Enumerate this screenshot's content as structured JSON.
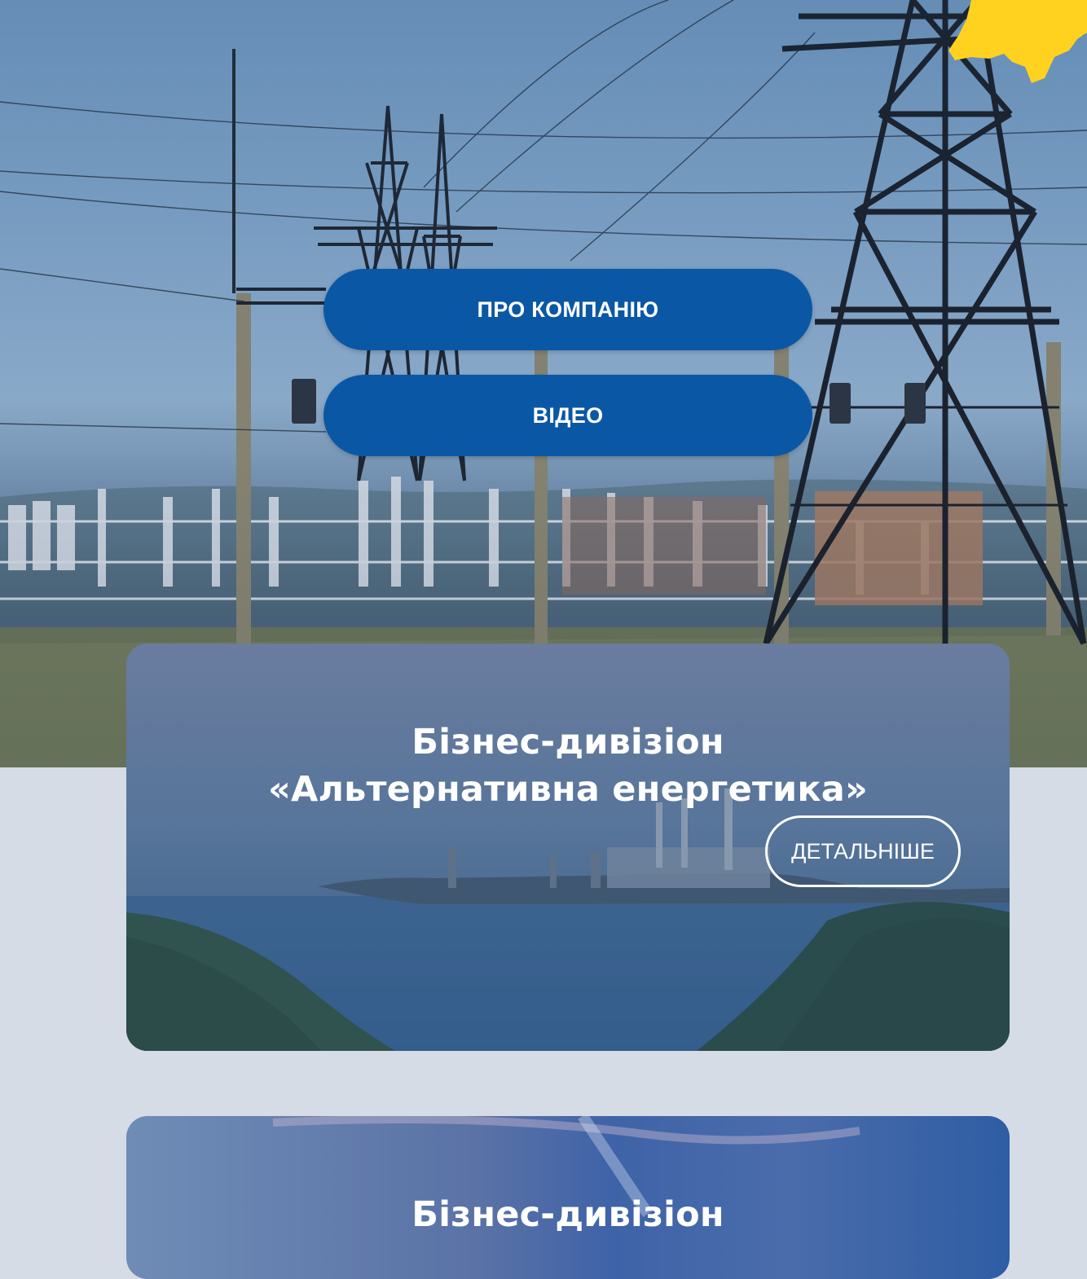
{
  "hero": {
    "buttons": {
      "about": "ПРО КОМПАНІЮ",
      "video": "ВІДЕО"
    },
    "accent_color": "#0a58a5",
    "map_color": "#ffd21f"
  },
  "divisions": [
    {
      "title": "Бізнес-дивізіон «Альтернативна енергетика»",
      "more_label": "ДЕТАЛЬНІШЕ"
    },
    {
      "title": "Бізнес-дивізіон"
    }
  ]
}
